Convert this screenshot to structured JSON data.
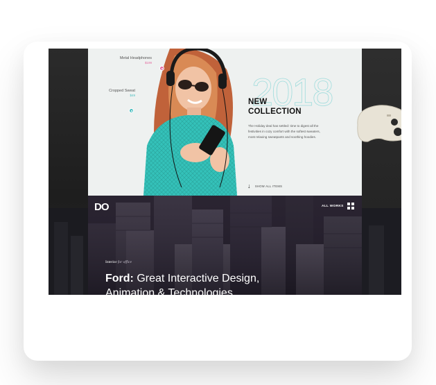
{
  "slide_top": {
    "hotspots": [
      {
        "name": "Metal Headphones",
        "price": "$199",
        "color": "#e46aa0"
      },
      {
        "name": "Cropped Sweat",
        "price": "$49",
        "color": "#4bbfc0"
      }
    ],
    "year": "2018",
    "headline_line1": "NEW",
    "headline_line2": "COLLECTION",
    "description": "The Holiday deal has settled: time to digest all the festivities in cozy comfort with the softest sweaters, most relaxing sweatpants and soothing hoodies.",
    "show_all_label": "SHOW ALL ITEMS"
  },
  "slide_bottom": {
    "logo": "DO",
    "all_works_label": "ALL WORKS",
    "category_main": "Interior",
    "category_sub": "for office",
    "title_brand": "Ford:",
    "title_line1_rest": "Great Interactive Design,",
    "title_line2": "Animation & Technologies"
  },
  "colors": {
    "accent_pink": "#e46aa0",
    "accent_teal": "#4bbfc0",
    "year_outline": "#9fdcdc"
  },
  "icons": [
    "gamepad-icon",
    "arrow-down-icon",
    "grid-menu-icon"
  ]
}
